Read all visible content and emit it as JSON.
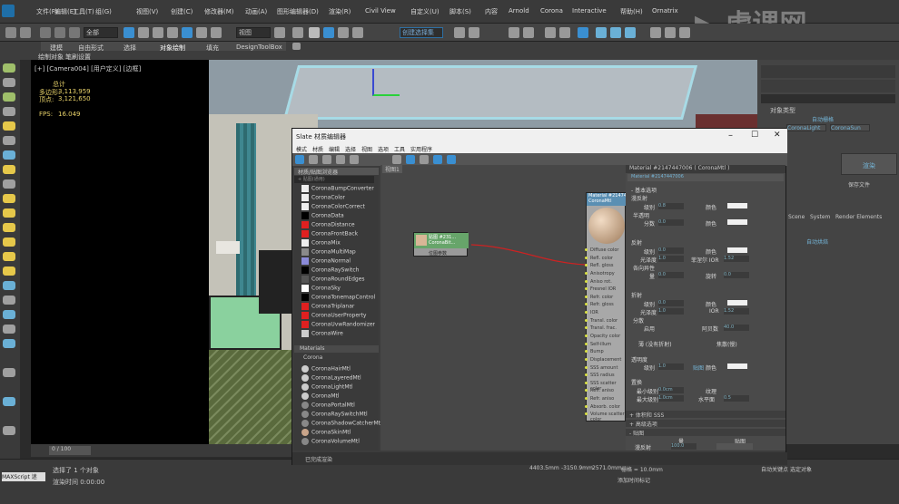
{
  "menu": [
    "文件(F)",
    "编辑(E)",
    "工具(T)",
    "组(G)",
    "视图(V)",
    "创建(C)",
    "修改器(M)",
    "动画(A)",
    "图形编辑器(D)",
    "渲染(R)",
    "Civil View",
    "自定义(U)",
    "脚本(S)",
    "内容",
    "Arnold",
    "Corona",
    "Interactive",
    "帮助(H)",
    "Ornatrix"
  ],
  "toolbar": {
    "select_mode": "全部",
    "view_label": "视图",
    "selection_set": "创建选择集"
  },
  "ribbon": {
    "tabs": [
      "建模",
      "自由形式",
      "选择",
      "对象绘制",
      "填充",
      "DesignToolBox"
    ],
    "sub": [
      "绘制对象",
      "笔刷设置"
    ]
  },
  "viewport": {
    "label": "[+] [Camera004] [用户定义] [边框]",
    "total_label": "总计",
    "poly_label": "多边形:",
    "poly_value": "3,113,959",
    "vert_label": "顶点:",
    "vert_value": "3,121,650",
    "fps_label": "FPS:",
    "fps_value": "16.049"
  },
  "slate": {
    "title": "Slate 材质编辑器",
    "menu": [
      "模式",
      "材质",
      "编辑",
      "选择",
      "视图",
      "选项",
      "工具",
      "实用程序"
    ],
    "browser_title": "材质/贴图浏览器",
    "search_placeholder": "按名称搜索...",
    "browser_group": "+ 贴图(通用)",
    "maps": [
      "CoronaBumpConverter",
      "CoronaColor",
      "CoronaColorCorrect",
      "CoronaData",
      "CoronaDistance",
      "CoronaFrontBack",
      "CoronaMix",
      "CoronaMultiMap",
      "CoronaNormal",
      "CoronaRaySwitch",
      "CoronaRoundEdges",
      "CoronaSky",
      "CoronaTonemapControl",
      "CoronaTriplanar",
      "CoronaUserProperty",
      "CoronaUvwRandomizer",
      "CoronaWire"
    ],
    "materials_label": "Materials",
    "corona_label": "Corona",
    "materials": [
      "CoronaHairMtl",
      "CoronaLayeredMtl",
      "CoronaLightMtl",
      "CoronaMtl",
      "CoronaPortalMtl",
      "CoronaRaySwitchMtl",
      "CoronaShadowCatcherMtl",
      "CoronaSkinMtl",
      "CoronaVolumeMtl"
    ],
    "view_tab": "视图1",
    "map_node": {
      "title": "贴图 #231...",
      "sub": "CoronaBit...",
      "footer": "位图参数"
    },
    "mtl_node": {
      "title": "Material #21474...",
      "sub": "CoronaMtl",
      "ports": [
        "Diffuse color",
        "Refl. color",
        "Refl. gloss",
        "Anisotropy",
        "Aniso rot.",
        "Fresnel IOR",
        "Refr. color",
        "Refr. gloss",
        "IOR",
        "Transl. color",
        "Transl. frac.",
        "Opacity color",
        "Self-illum",
        "Bump",
        "Displacement",
        "SSS amount",
        "SSS radius",
        "SSS scatter color",
        "Refl. aniso",
        "Refr. aniso",
        "Absorb. color",
        "Volume scatter color"
      ]
    },
    "params_title": "Material #2147447006 ( CoronaMtl )",
    "params_sub": "Material #2147447006",
    "basic_opts": "- 基本选项",
    "diffuse": {
      "head": "漫反射",
      "level": "级别",
      "level_v": "0.8",
      "color": "颜色",
      "translucency": "半透明",
      "fraction": "分数",
      "fraction_v": "0.0"
    },
    "reflection": {
      "head": "反射",
      "level": "级别",
      "level_v": "0.0",
      "color": "颜色",
      "gloss": "光泽度",
      "gloss_v": "1.0",
      "fresnel": "菲涅尔 IOR",
      "fresnel_v": "1.52",
      "aniso": "各向异性",
      "amount": "量",
      "amount_v": "0.0",
      "rot": "旋转",
      "rot_v": "0.0"
    },
    "refraction": {
      "head": "折射",
      "level": "级别",
      "level_v": "0.0",
      "color": "颜色",
      "gloss": "光泽度",
      "gloss_v": "1.0",
      "ior": "IOR",
      "ior_v": "1.52",
      "disp": "分散",
      "enable": "启用",
      "abbe": "阿贝数",
      "abbe_v": "40.0",
      "thin": "薄 (没有折射)",
      "caustics": "焦散(慢)"
    },
    "opacity": {
      "head": "透明度",
      "level": "级别",
      "level_v": "1.0",
      "map": "贴图",
      "color": "颜色"
    },
    "disp": {
      "head": "置换",
      "min": "最小级别",
      "min_v": "0.0cm",
      "tex": "纹理",
      "max": "最大级别",
      "max_v": "1.0cm",
      "water": "水平面",
      "water_v": "0.5"
    },
    "rollouts": [
      "+ 体积和 SSS",
      "+ 高级选项",
      "- 贴图"
    ],
    "maps_head": {
      "amount": "量",
      "map": "贴图"
    },
    "diffuse_map": "漫反射",
    "diffuse_map_amt": "100.0",
    "status": "已完成渲染"
  },
  "right": {
    "object_type": "对象类型",
    "auto_grid": "自动栅格",
    "corona_light": "CoronaLight",
    "corona_sun": "CoronaSun",
    "render": "渲染",
    "save_file": "保存文件",
    "tabs": [
      "Scene",
      "System",
      "Render Elements"
    ],
    "bake": "自动烘焙"
  },
  "timeline": {
    "frame": "0 / 100"
  },
  "status": {
    "selected": "选择了 1 个对象",
    "render_time": "渲染时间 0:00:00",
    "maxscript": "MAXScript 迷",
    "grid": "栅格 = 10.0mm",
    "add_time_tag": "添加时间标记",
    "x": "4403.5mm",
    "y": "-3150.9mm",
    "z": "2571.0mm",
    "auto": "自动关键点",
    "sel": "选定对象"
  }
}
